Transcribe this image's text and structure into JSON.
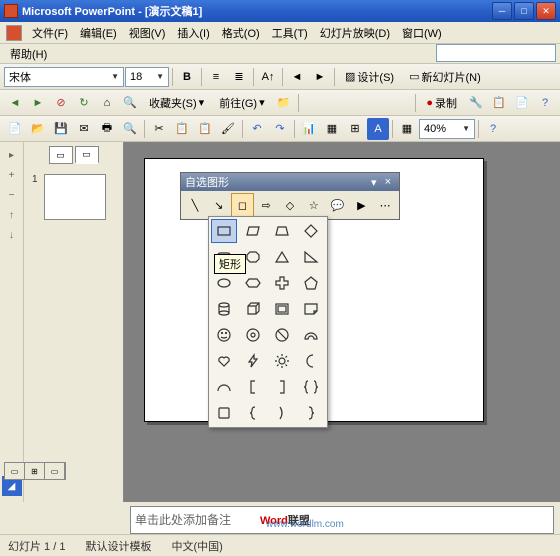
{
  "window": {
    "title": "Microsoft PowerPoint - [演示文稿1]"
  },
  "menu": {
    "file": "文件(F)",
    "edit": "编辑(E)",
    "view": "视图(V)",
    "insert": "插入(I)",
    "format": "格式(O)",
    "tools": "工具(T)",
    "slideshow": "幻灯片放映(D)",
    "window": "窗口(W)",
    "help": "帮助(H)"
  },
  "format_tb": {
    "font": "宋体",
    "size": "18",
    "design": "设计(S)",
    "newslide": "新幻灯片(N)"
  },
  "web_tb": {
    "fav": "收藏夹(S)",
    "go": "前往(G)"
  },
  "rec_tb": {
    "record": "录制"
  },
  "std_tb": {
    "zoom": "40%"
  },
  "slide": {
    "num": "1"
  },
  "autoshape": {
    "title": "自选图形",
    "tooltip": "矩形"
  },
  "notes": {
    "placeholder": "单击此处添加备注"
  },
  "status": {
    "slide": "幻灯片 1 / 1",
    "template": "默认设计模板",
    "lang": "中文(中国)"
  },
  "watermark": {
    "brand1": "Word",
    "brand2": "联盟",
    "url": "www.wordlm.com"
  }
}
